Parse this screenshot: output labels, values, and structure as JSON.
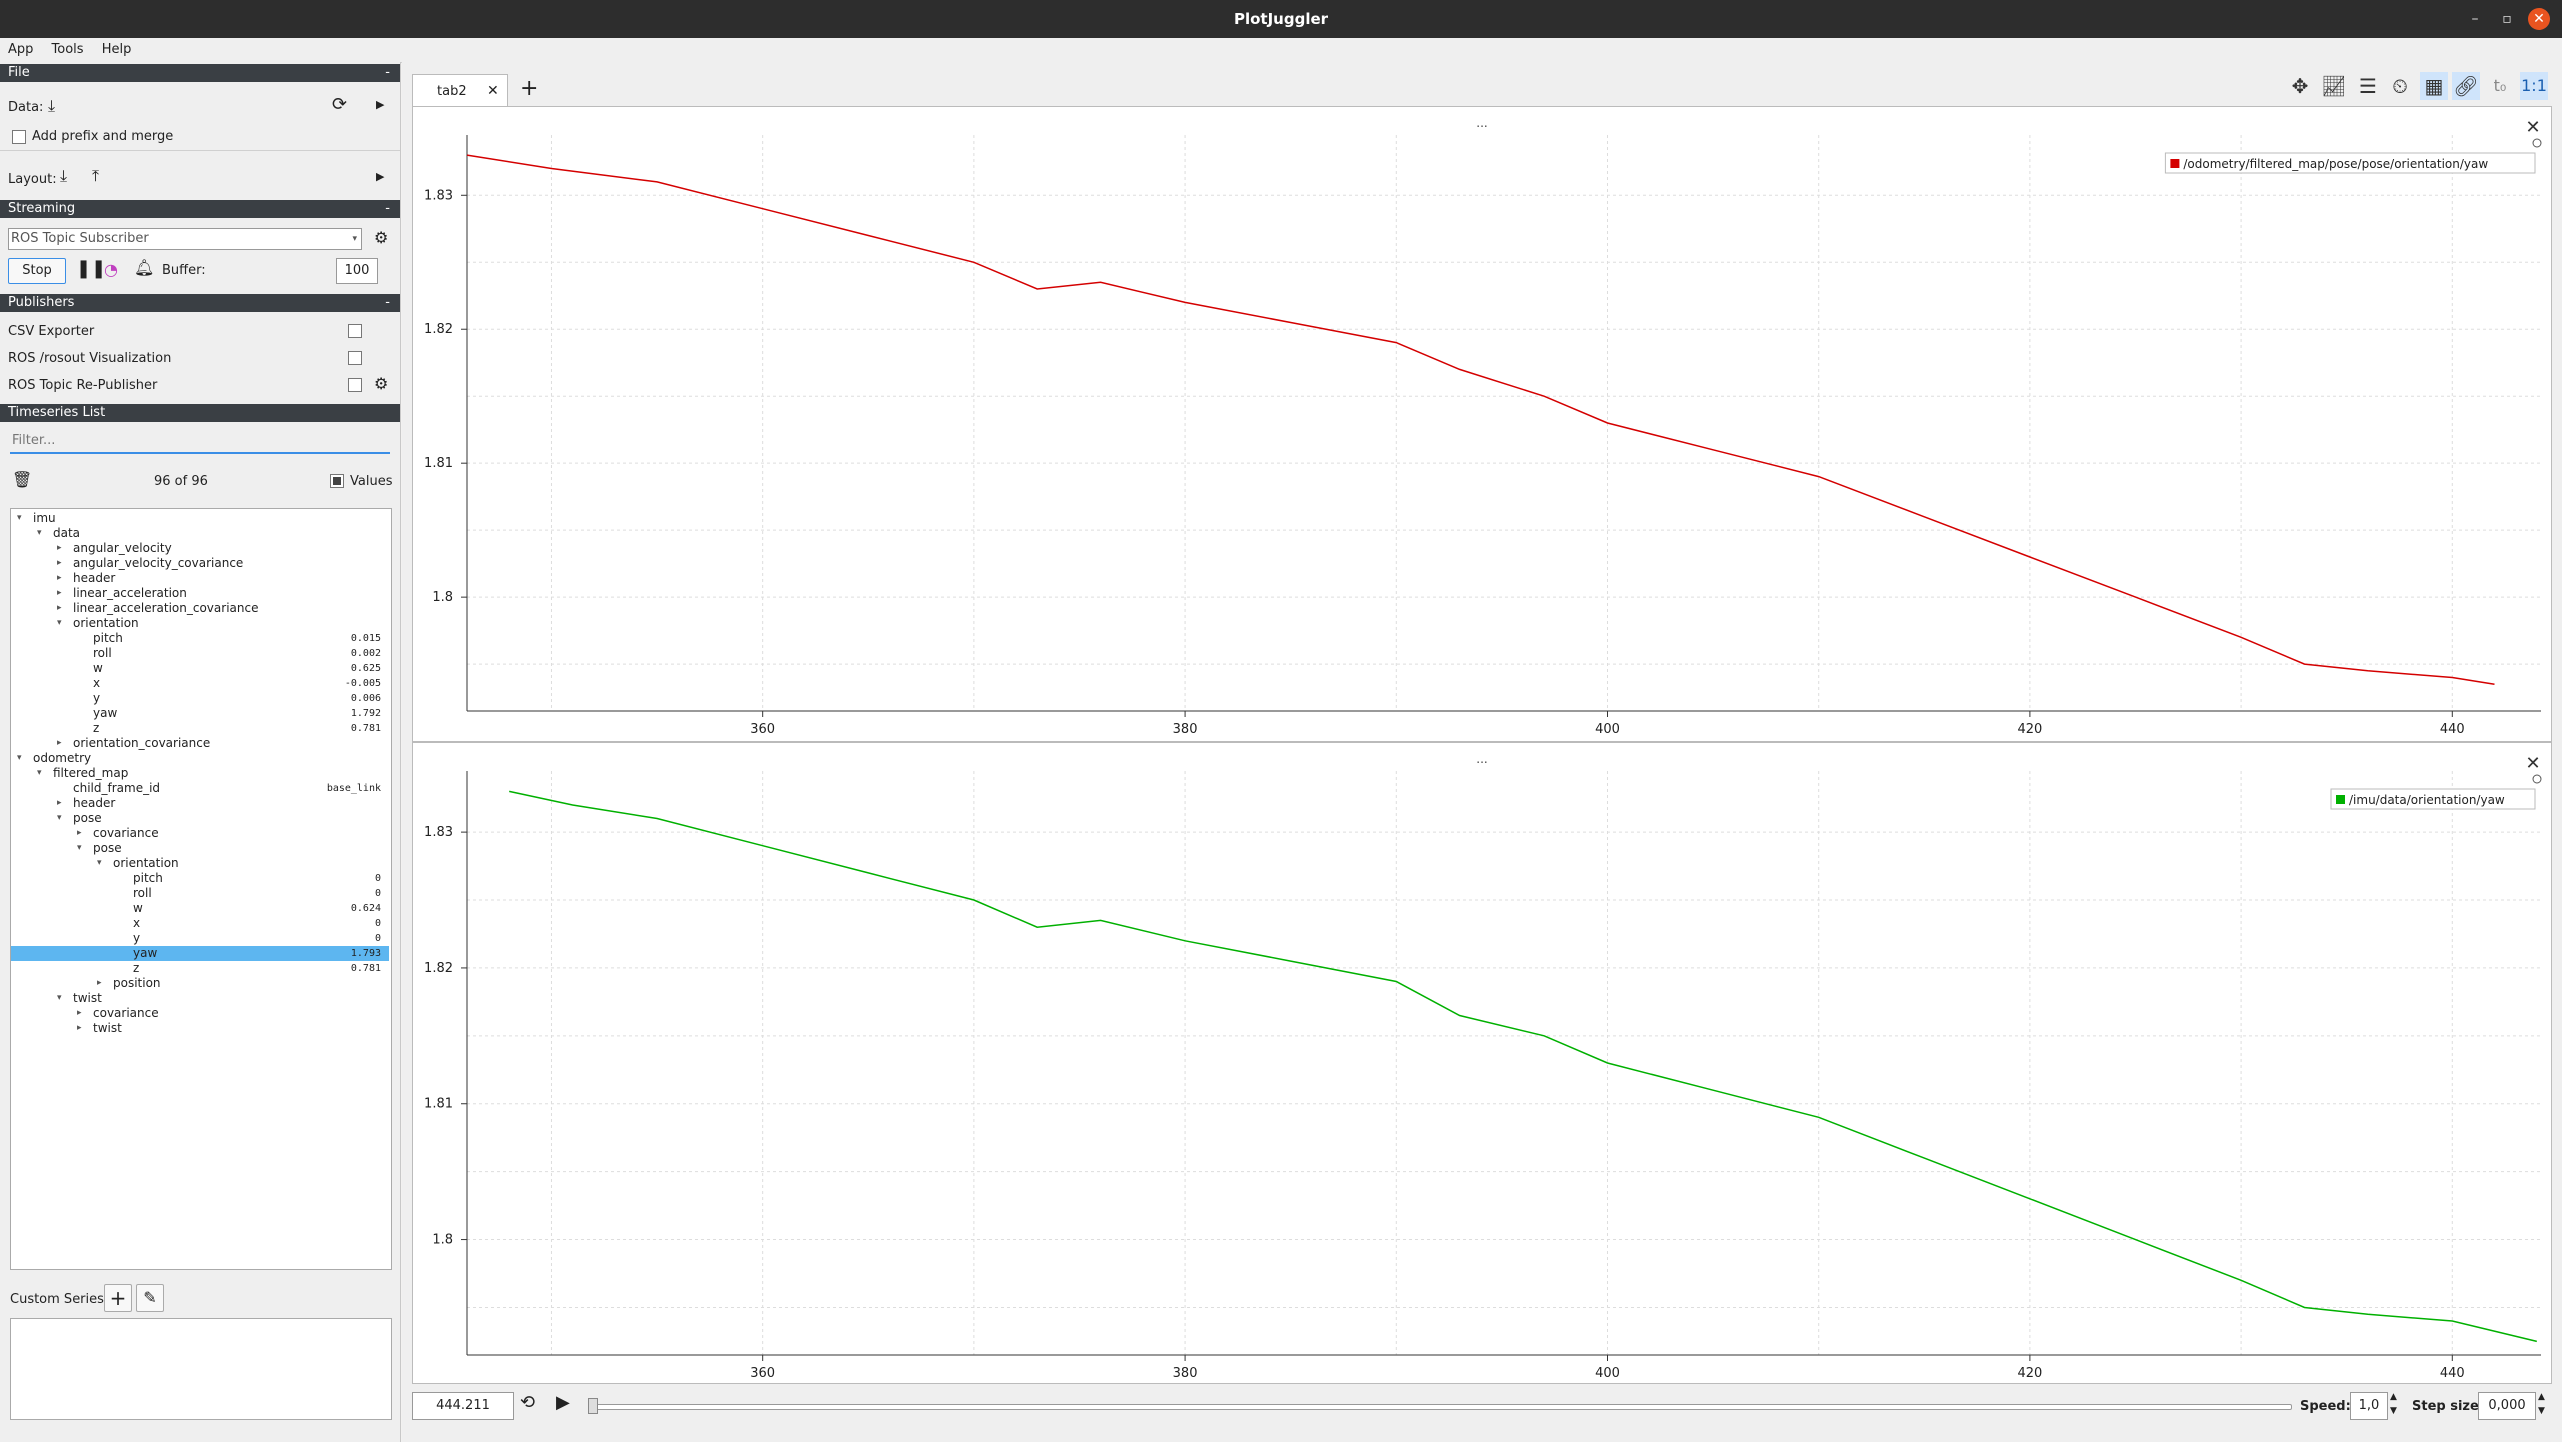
{
  "window": {
    "title": "PlotJuggler"
  },
  "menu": [
    "App",
    "Tools",
    "Help"
  ],
  "file": {
    "header": "File",
    "data_label": "Data:",
    "add_prefix_label": "Add prefix and merge",
    "layout_label": "Layout:"
  },
  "streaming": {
    "header": "Streaming",
    "source": "ROS Topic Subscriber",
    "stop_label": "Stop",
    "buffer_label": "Buffer:",
    "buffer_value": "100"
  },
  "publishers": {
    "header": "Publishers",
    "items": [
      "CSV Exporter",
      "ROS /rosout Visualization",
      "ROS Topic Re-Publisher"
    ]
  },
  "timeseries": {
    "header": "Timeseries List",
    "filter_placeholder": "Filter...",
    "count": "96 of 96",
    "values_label": "Values",
    "tree": [
      {
        "label": "imu",
        "depth": 0,
        "arrow": "open",
        "value": ""
      },
      {
        "label": "data",
        "depth": 1,
        "arrow": "open",
        "value": ""
      },
      {
        "label": "angular_velocity",
        "depth": 2,
        "arrow": "closed",
        "value": ""
      },
      {
        "label": "angular_velocity_covariance",
        "depth": 2,
        "arrow": "closed",
        "value": ""
      },
      {
        "label": "header",
        "depth": 2,
        "arrow": "closed",
        "value": ""
      },
      {
        "label": "linear_acceleration",
        "depth": 2,
        "arrow": "closed",
        "value": ""
      },
      {
        "label": "linear_acceleration_covariance",
        "depth": 2,
        "arrow": "closed",
        "value": ""
      },
      {
        "label": "orientation",
        "depth": 2,
        "arrow": "open",
        "value": ""
      },
      {
        "label": "pitch",
        "depth": 3,
        "arrow": "",
        "value": "0.015"
      },
      {
        "label": "roll",
        "depth": 3,
        "arrow": "",
        "value": "0.002"
      },
      {
        "label": "w",
        "depth": 3,
        "arrow": "",
        "value": "0.625"
      },
      {
        "label": "x",
        "depth": 3,
        "arrow": "",
        "value": "-0.005"
      },
      {
        "label": "y",
        "depth": 3,
        "arrow": "",
        "value": "0.006"
      },
      {
        "label": "yaw",
        "depth": 3,
        "arrow": "",
        "value": "1.792"
      },
      {
        "label": "z",
        "depth": 3,
        "arrow": "",
        "value": "0.781"
      },
      {
        "label": "orientation_covariance",
        "depth": 2,
        "arrow": "closed",
        "value": ""
      },
      {
        "label": "odometry",
        "depth": 0,
        "arrow": "open",
        "value": ""
      },
      {
        "label": "filtered_map",
        "depth": 1,
        "arrow": "open",
        "value": ""
      },
      {
        "label": "child_frame_id",
        "depth": 2,
        "arrow": "",
        "value": "base_link"
      },
      {
        "label": "header",
        "depth": 2,
        "arrow": "closed",
        "value": ""
      },
      {
        "label": "pose",
        "depth": 2,
        "arrow": "open",
        "value": ""
      },
      {
        "label": "covariance",
        "depth": 3,
        "arrow": "closed",
        "value": ""
      },
      {
        "label": "pose",
        "depth": 3,
        "arrow": "open",
        "value": ""
      },
      {
        "label": "orientation",
        "depth": 4,
        "arrow": "open",
        "value": ""
      },
      {
        "label": "pitch",
        "depth": 5,
        "arrow": "",
        "value": "0"
      },
      {
        "label": "roll",
        "depth": 5,
        "arrow": "",
        "value": "0"
      },
      {
        "label": "w",
        "depth": 5,
        "arrow": "",
        "value": "0.624"
      },
      {
        "label": "x",
        "depth": 5,
        "arrow": "",
        "value": "0"
      },
      {
        "label": "y",
        "depth": 5,
        "arrow": "",
        "value": "0"
      },
      {
        "label": "yaw",
        "depth": 5,
        "arrow": "",
        "value": "1.793",
        "selected": true
      },
      {
        "label": "z",
        "depth": 5,
        "arrow": "",
        "value": "0.781"
      },
      {
        "label": "position",
        "depth": 4,
        "arrow": "closed",
        "value": ""
      },
      {
        "label": "twist",
        "depth": 2,
        "arrow": "open",
        "value": ""
      },
      {
        "label": "covariance",
        "depth": 3,
        "arrow": "closed",
        "value": ""
      },
      {
        "label": "twist",
        "depth": 3,
        "arrow": "closed",
        "value": ""
      }
    ]
  },
  "custom_series": {
    "label": "Custom Series:"
  },
  "tabs": [
    {
      "label": "tab2"
    }
  ],
  "plots": [
    {
      "title": "...",
      "legend": "/odometry/filtered_map/pose/pose/orientation/yaw",
      "color": "#d40000"
    },
    {
      "title": "...",
      "legend": "/imu/data/orientation/yaw",
      "color": "#00b000"
    }
  ],
  "chart_data": [
    {
      "type": "line",
      "series": [
        {
          "name": "/odometry/filtered_map/pose/pose/orientation/yaw",
          "color": "#d40000",
          "x": [
            346,
            350,
            355,
            360,
            365,
            370,
            373,
            376,
            380,
            385,
            390,
            393,
            397,
            400,
            405,
            410,
            415,
            420,
            425,
            430,
            433,
            436,
            440,
            442
          ],
          "y": [
            1.833,
            1.832,
            1.831,
            1.829,
            1.827,
            1.825,
            1.823,
            1.8235,
            1.822,
            1.8205,
            1.819,
            1.817,
            1.815,
            1.813,
            1.811,
            1.809,
            1.806,
            1.803,
            1.8,
            1.797,
            1.795,
            1.7945,
            1.794,
            1.7935
          ]
        }
      ],
      "x_ticks": [
        360,
        380,
        400,
        420,
        440
      ],
      "y_ticks": [
        1.8,
        1.81,
        1.82,
        1.83
      ],
      "xlim": [
        346,
        444.2
      ],
      "ylim": [
        1.7915,
        1.8345
      ],
      "grid": true,
      "legend": "top-right"
    },
    {
      "type": "line",
      "series": [
        {
          "name": "/imu/data/orientation/yaw",
          "color": "#00b000",
          "x": [
            348,
            351,
            355,
            360,
            365,
            370,
            373,
            376,
            380,
            385,
            390,
            393,
            397,
            400,
            405,
            410,
            415,
            420,
            425,
            430,
            433,
            436,
            440,
            444
          ],
          "y": [
            1.833,
            1.832,
            1.831,
            1.829,
            1.827,
            1.825,
            1.823,
            1.8235,
            1.822,
            1.8205,
            1.819,
            1.8165,
            1.815,
            1.813,
            1.811,
            1.809,
            1.806,
            1.803,
            1.8,
            1.797,
            1.795,
            1.7945,
            1.794,
            1.7925
          ]
        }
      ],
      "x_ticks": [
        360,
        380,
        400,
        420,
        440
      ],
      "y_ticks": [
        1.8,
        1.81,
        1.82,
        1.83
      ],
      "xlim": [
        346,
        444.2
      ],
      "ylim": [
        1.7915,
        1.8345
      ],
      "grid": true,
      "legend": "top-right"
    }
  ],
  "playback": {
    "time": "444.211",
    "speed_label": "Speed:",
    "speed_value": "1,0",
    "step_label": "Step size:",
    "step_value": "0,000"
  },
  "colors": {
    "header_bg": "#3a3f44",
    "selection": "#5db6f0",
    "accent": "#e95420"
  }
}
